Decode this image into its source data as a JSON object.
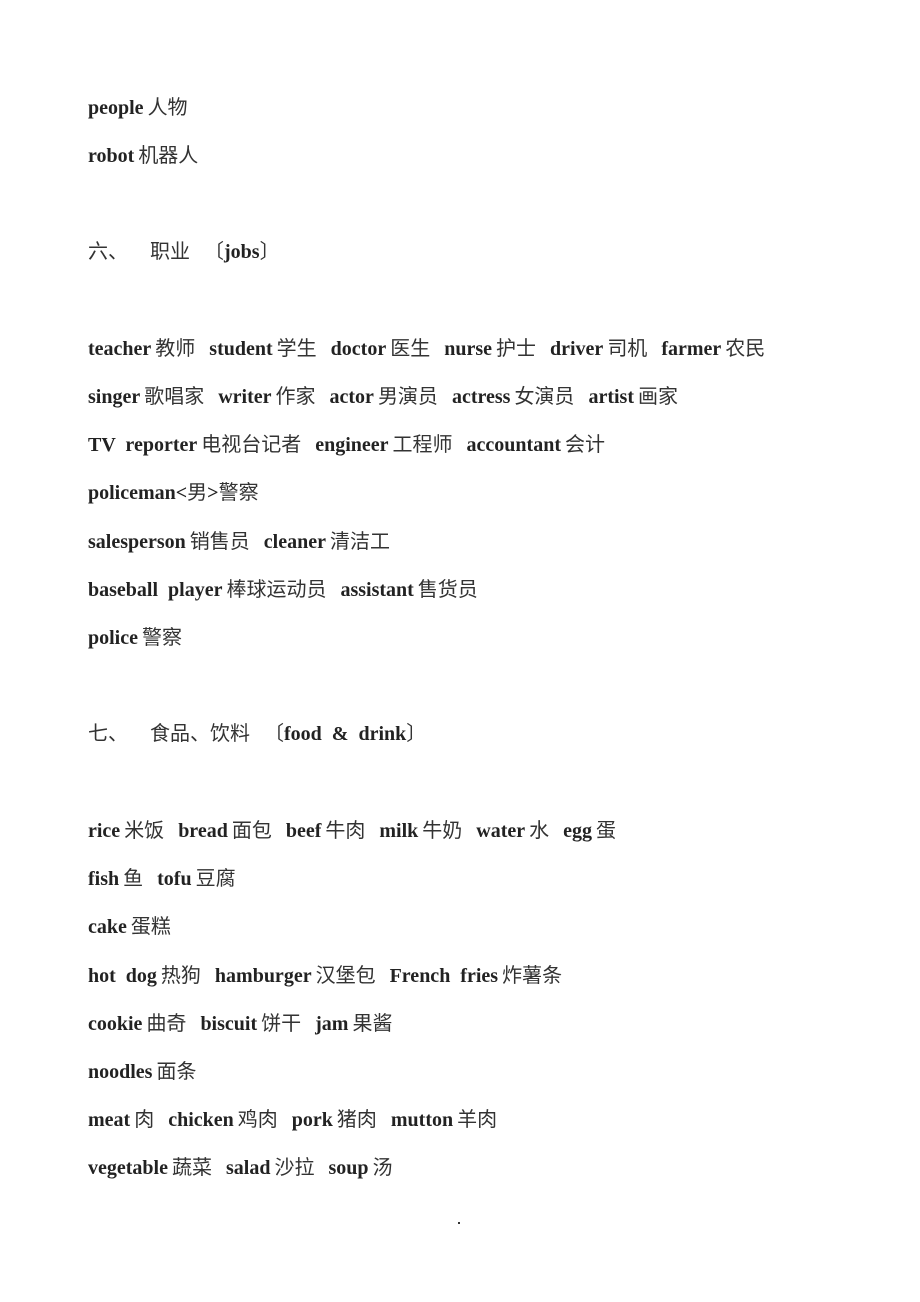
{
  "lines": [
    {
      "items": [
        {
          "en": "people",
          "zh": "人物"
        }
      ]
    },
    {
      "items": [
        {
          "en": "robot",
          "zh": "机器人"
        }
      ]
    },
    {
      "heading": {
        "num": "六、",
        "zh": "职业",
        "en": "jobs"
      }
    },
    {
      "items": [
        {
          "en": "teacher",
          "zh": "教师"
        },
        {
          "en": "student",
          "zh": "学生"
        },
        {
          "en": "doctor",
          "zh": "医生"
        },
        {
          "en": "nurse",
          "zh": "护士"
        },
        {
          "en": "driver",
          "zh": "司机"
        },
        {
          "en": "farmer",
          "zh": "农民"
        }
      ]
    },
    {
      "items": [
        {
          "en": "singer",
          "zh": "歌唱家"
        },
        {
          "en": "writer",
          "zh": "作家"
        },
        {
          "en": "actor",
          "zh": "男演员"
        },
        {
          "en": "actress",
          "zh": "女演员"
        },
        {
          "en": "artist",
          "zh": "画家"
        }
      ]
    },
    {
      "items": [
        {
          "en": "TV  reporter",
          "zh": "电视台记者"
        },
        {
          "en": "engineer",
          "zh": "工程师"
        },
        {
          "en": "accountant",
          "zh": "会计"
        }
      ]
    },
    {
      "items": [
        {
          "en": "policeman<",
          "zh": "男"
        },
        {
          "en": ">",
          "zh": "警察"
        }
      ]
    },
    {
      "items": [
        {
          "en": "salesperson",
          "zh": "销售员"
        },
        {
          "en": "cleaner",
          "zh": "清洁工"
        }
      ]
    },
    {
      "items": [
        {
          "en": "baseball  player",
          "zh": "棒球运动员"
        },
        {
          "en": "assistant",
          "zh": "售货员"
        }
      ]
    },
    {
      "items": [
        {
          "en": "police",
          "zh": "警察"
        }
      ]
    },
    {
      "heading": {
        "num": "七、",
        "zh": "食品、饮料",
        "en": "food  &  drink"
      }
    },
    {
      "items": [
        {
          "en": "rice",
          "zh": "米饭"
        },
        {
          "en": "bread",
          "zh": "面包"
        },
        {
          "en": "beef",
          "zh": "牛肉"
        },
        {
          "en": "milk",
          "zh": "牛奶"
        },
        {
          "en": "water",
          "zh": "水"
        },
        {
          "en": "egg",
          "zh": "蛋"
        }
      ]
    },
    {
      "items": [
        {
          "en": "fish",
          "zh": "鱼"
        },
        {
          "en": "tofu",
          "zh": "豆腐"
        }
      ]
    },
    {
      "items": [
        {
          "en": "cake",
          "zh": "蛋糕"
        }
      ]
    },
    {
      "items": [
        {
          "en": "hot  dog",
          "zh": "热狗"
        },
        {
          "en": "hamburger",
          "zh": "汉堡包"
        },
        {
          "en": "French  fries",
          "zh": "炸薯条"
        }
      ]
    },
    {
      "items": [
        {
          "en": "cookie",
          "zh": "曲奇"
        },
        {
          "en": "biscuit",
          "zh": "饼干"
        },
        {
          "en": "jam",
          "zh": "果酱"
        }
      ]
    },
    {
      "items": [
        {
          "en": "noodles",
          "zh": "面条"
        }
      ]
    },
    {
      "items": [
        {
          "en": "meat",
          "zh": "肉"
        },
        {
          "en": "chicken",
          "zh": "鸡肉"
        },
        {
          "en": "pork",
          "zh": "猪肉"
        },
        {
          "en": "mutton",
          "zh": "羊肉"
        }
      ]
    },
    {
      "items": [
        {
          "en": "vegetable",
          "zh": "蔬菜"
        },
        {
          "en": "salad",
          "zh": "沙拉"
        },
        {
          "en": "soup",
          "zh": "汤"
        }
      ]
    }
  ]
}
